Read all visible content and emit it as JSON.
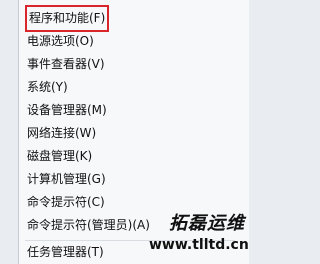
{
  "menu": {
    "items": [
      {
        "label": "程序和功能(F)",
        "highlighted": true
      },
      {
        "label": "电源选项(O)"
      },
      {
        "label": "事件查看器(V)"
      },
      {
        "label": "系统(Y)"
      },
      {
        "label": "设备管理器(M)"
      },
      {
        "label": "网络连接(W)"
      },
      {
        "label": "磁盘管理(K)"
      },
      {
        "label": "计算机管理(G)"
      },
      {
        "label": "命令提示符(C)"
      },
      {
        "label": "命令提示符(管理员)(A)"
      },
      {
        "label": "任务管理器(T)"
      }
    ]
  },
  "watermark": {
    "text_top": "拓磊运维",
    "text_bottom": "www.tlltd.cn"
  },
  "colors": {
    "highlight_border": "#d9262b",
    "menu_background": "#f7f8fa",
    "text": "#111111"
  }
}
